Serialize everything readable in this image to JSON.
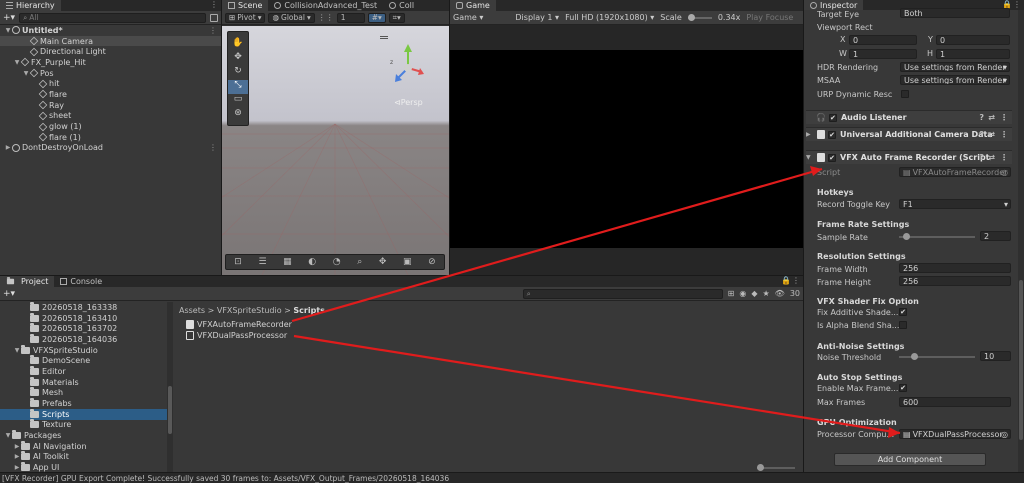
{
  "hierarchy": {
    "tab": "Hierarchy",
    "search_placeholder": "All",
    "items": [
      {
        "label": "Untitled*",
        "indent": 0,
        "bold": true
      },
      {
        "label": "Main Camera",
        "indent": 2
      },
      {
        "label": "Directional Light",
        "indent": 2
      },
      {
        "label": "FX_Purple_Hit",
        "indent": 1
      },
      {
        "label": "Pos",
        "indent": 2
      },
      {
        "label": "hit",
        "indent": 3
      },
      {
        "label": "flare",
        "indent": 3
      },
      {
        "label": "Ray",
        "indent": 3
      },
      {
        "label": "sheet",
        "indent": 3
      },
      {
        "label": "glow (1)",
        "indent": 3
      },
      {
        "label": "flare (1)",
        "indent": 3
      },
      {
        "label": "DontDestroyOnLoad",
        "indent": 0
      }
    ]
  },
  "scene": {
    "tabs": [
      "Scene",
      "CollisionAdvanced_Test",
      "Coll"
    ],
    "pivot": "Pivot",
    "global": "Global",
    "grid_num": "1",
    "persp": "Persp"
  },
  "game": {
    "tab": "Game",
    "mode": "Game",
    "display": "Display 1",
    "resolution": "Full HD (1920x1080)",
    "scale_label": "Scale",
    "scale_value": "0.34x",
    "play_focus": "Play Focuse"
  },
  "inspector": {
    "tab": "Inspector",
    "camera_fields": {
      "target_eye_label": "Target Eye",
      "target_eye_value": "Both",
      "viewport_rect": "Viewport Rect",
      "x_label": "X",
      "x_value": "0",
      "y_label": "Y",
      "y_value": "0",
      "w_label": "W",
      "w_value": "1",
      "h_label": "H",
      "h_value": "1",
      "hdr_label": "HDR Rendering",
      "hdr_value": "Use settings from Render",
      "msaa_label": "MSAA",
      "msaa_value": "Use settings from Render",
      "urp_label": "URP Dynamic Resc"
    },
    "components": {
      "audio_listener": "Audio Listener",
      "universal_camera": "Universal Additional Camera Data",
      "vfx_recorder": "VFX Auto Frame Recorder (Script"
    },
    "script_label": "Script",
    "script_value": "VFXAutoFrameRecorder",
    "hotkeys": {
      "title": "Hotkeys",
      "record_label": "Record Toggle Key",
      "record_value": "F1"
    },
    "frame_rate": {
      "title": "Frame Rate Settings",
      "sample_label": "Sample Rate",
      "sample_value": "2"
    },
    "resolution": {
      "title": "Resolution Settings",
      "width_label": "Frame Width",
      "width_value": "256",
      "height_label": "Frame Height",
      "height_value": "256"
    },
    "shader_fix": {
      "title": "VFX Shader Fix Option",
      "additive_label": "Fix Additive Shade...",
      "alpha_label": "Is Alpha Blend Sha..."
    },
    "anti_noise": {
      "title": "Anti-Noise Settings",
      "threshold_label": "Noise Threshold",
      "threshold_value": "10"
    },
    "auto_stop": {
      "title": "Auto Stop Settings",
      "enable_label": "Enable Max Frame...",
      "max_label": "Max Frames",
      "max_value": "600"
    },
    "gpu": {
      "title": "GPU Optimization",
      "processor_label": "Processor Compu...",
      "processor_value": "VFXDualPassProcessor"
    },
    "add_component": "Add Component"
  },
  "project": {
    "tabs": [
      "Project",
      "Console"
    ],
    "breadcrumb": [
      "Assets",
      "VFXSpriteStudio",
      "Scripts"
    ],
    "tree": [
      {
        "label": "20260518_163338",
        "indent": 2
      },
      {
        "label": "20260518_163410",
        "indent": 2
      },
      {
        "label": "20260518_163702",
        "indent": 2
      },
      {
        "label": "20260518_164036",
        "indent": 2
      },
      {
        "label": "VFXSpriteStudio",
        "indent": 1,
        "open": true
      },
      {
        "label": "DemoScene",
        "indent": 2
      },
      {
        "label": "Editor",
        "indent": 2
      },
      {
        "label": "Materials",
        "indent": 2
      },
      {
        "label": "Mesh",
        "indent": 2
      },
      {
        "label": "Prefabs",
        "indent": 2
      },
      {
        "label": "Scripts",
        "indent": 2,
        "selected": true
      },
      {
        "label": "Texture",
        "indent": 2
      },
      {
        "label": "Packages",
        "indent": 0,
        "open": true
      },
      {
        "label": "AI Navigation",
        "indent": 1
      },
      {
        "label": "AI Toolkit",
        "indent": 1
      },
      {
        "label": "App UI",
        "indent": 1
      }
    ],
    "files": [
      "VFXAutoFrameRecorder",
      "VFXDualPassProcessor"
    ],
    "count": "30"
  },
  "status_bar": "[VFX Recorder] GPU Export Complete! Successfully saved 30 frames to: Assets/VFX_Output_Frames/20260518_164036",
  "colors": {
    "annotation_arrow": "#e01c1c",
    "selection": "#2c5d87"
  }
}
